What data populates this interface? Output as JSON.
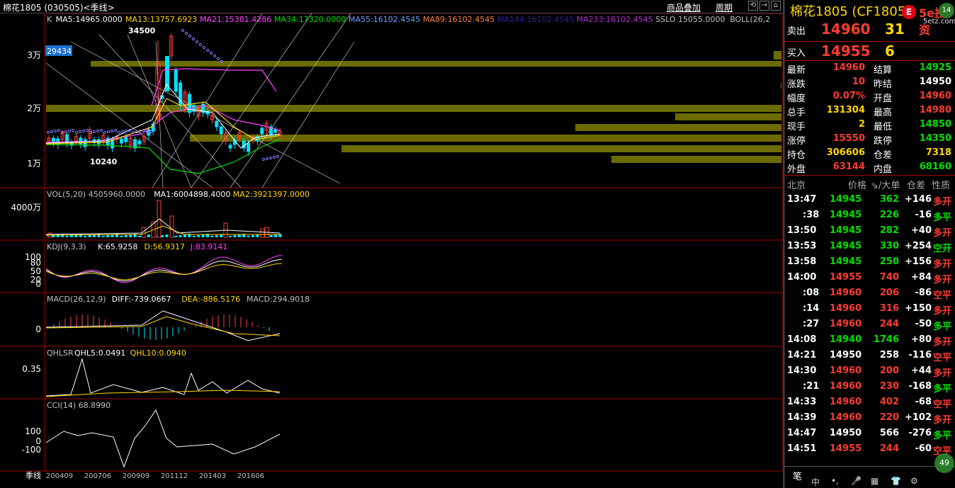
{
  "topbar": {
    "title": "棉花1805 (030505)<季线>",
    "btn_overlay": "商品叠加",
    "btn_period": "周期",
    "icon_back": "⟲",
    "icon_fwd": "→",
    "icon_home": "⌂"
  },
  "main": {
    "legend": [
      {
        "t": "K",
        "c": "#c0c0c0"
      },
      {
        "t": "MA5:14965.0000",
        "c": "#ffffff"
      },
      {
        "t": "MA13:13757.6923",
        "c": "#ffd700"
      },
      {
        "t": "MA21:15381.4286",
        "c": "#ff40ff"
      },
      {
        "t": "MA34:17320.0000",
        "c": "#00e000"
      },
      {
        "t": "MA55:16102.4545",
        "c": "#6aa0ff"
      },
      {
        "t": "MA89:16102.4545",
        "c": "#ff8040"
      },
      {
        "t": "MA144:16102.4545",
        "c": "#1b2a9a"
      },
      {
        "t": "MA233:16102.4545",
        "c": "#b030d0"
      },
      {
        "t": "SSLO 15055.0000",
        "c": "#c0c0c0"
      },
      {
        "t": "BOLL(26,2",
        "c": "#c0c0c0"
      }
    ],
    "y_labels": [
      "3万",
      "2万",
      "1万"
    ],
    "high_tag": "34500",
    "low_tag": "10240",
    "cursor_value": "29434"
  },
  "vol": {
    "legend": [
      {
        "t": "VOL(5,20) 4505960.0000",
        "c": "#c0c0c0"
      },
      {
        "t": "MA1:6004898.4000",
        "c": "#ffffff"
      },
      {
        "t": "MA2:3921397.0000",
        "c": "#ffd700"
      }
    ],
    "y_label": "4000万"
  },
  "kdj": {
    "legend": [
      {
        "t": "KDJ(9,3,3)",
        "c": "#c0c0c0"
      },
      {
        "t": "K:65.9258",
        "c": "#ffffff"
      },
      {
        "t": "D:56.9317",
        "c": "#ffd700"
      },
      {
        "t": "J:83.9141",
        "c": "#ff40ff"
      }
    ],
    "y_labels": [
      "100",
      "80",
      "50",
      "20",
      "0"
    ]
  },
  "macd": {
    "legend": [
      {
        "t": "MACD(26,12,9)",
        "c": "#c0c0c0"
      },
      {
        "t": "DIFF:-739.0667",
        "c": "#ffffff"
      },
      {
        "t": "DEA:-886.5176",
        "c": "#ffd700"
      },
      {
        "t": "MACD:294.9018",
        "c": "#c0c0c0"
      }
    ],
    "y_label": "0"
  },
  "qhlsr": {
    "legend": [
      {
        "t": "QHLSR",
        "c": "#c0c0c0"
      },
      {
        "t": "QHL5:0.0491",
        "c": "#ffffff"
      },
      {
        "t": "QHL10:0.0940",
        "c": "#ffd700"
      }
    ],
    "y_label": "0.35"
  },
  "cci": {
    "legend": [
      {
        "t": "CCI(14) 68.8990",
        "c": "#c0c0c0"
      }
    ],
    "y_labels": [
      "100",
      "0",
      "-100"
    ]
  },
  "x_axis": {
    "period": "季线",
    "labels": [
      "200409",
      "200706",
      "200909",
      "201112",
      "201403",
      "201606"
    ]
  },
  "right": {
    "title": "棉花1805 (CF1805)",
    "logo_main": "5e投资",
    "logo_sub": "5etz.com",
    "logo_char": "E",
    "sell_label": "卖出",
    "sell_price": "14960",
    "sell_vol": "31",
    "buy_label": "买入",
    "buy_price": "14955",
    "buy_vol": "6",
    "stats": [
      {
        "l1": "最新",
        "v1": "14960",
        "c1": "red",
        "l2": "结算",
        "v2": "14925",
        "c2": "green"
      },
      {
        "l1": "涨跌",
        "v1": "10",
        "c1": "red",
        "l2": "昨结",
        "v2": "14950",
        "c2": "white"
      },
      {
        "l1": "幅度",
        "v1": "0.07%",
        "c1": "red",
        "l2": "开盘",
        "v2": "14960",
        "c2": "red"
      },
      {
        "l1": "总手",
        "v1": "131304",
        "c1": "yellow",
        "l2": "最高",
        "v2": "14980",
        "c2": "red"
      },
      {
        "l1": "现手",
        "v1": "2",
        "c1": "yellow",
        "l2": "最低",
        "v2": "14850",
        "c2": "green"
      },
      {
        "l1": "涨停",
        "v1": "15550",
        "c1": "red",
        "l2": "跌停",
        "v2": "14350",
        "c2": "green"
      },
      {
        "l1": "持仓",
        "v1": "306606",
        "c1": "yellow",
        "l2": "仓差",
        "v2": "7318",
        "c2": "yellow"
      },
      {
        "l1": "外盘",
        "v1": "63144",
        "c1": "red",
        "l2": "内盘",
        "v2": "68160",
        "c2": "green"
      }
    ],
    "tick_head": {
      "loc": "北京",
      "price": "价格",
      "vol": "⇘/大单",
      "oi": "仓差",
      "nature": "性质"
    },
    "ticks": [
      {
        "t": "13:47",
        "p": "14945",
        "pc": "green",
        "v": "362",
        "oi": "+146",
        "n": "多开",
        "nc": "red"
      },
      {
        "t": ":38",
        "p": "14945",
        "pc": "green",
        "v": "226",
        "oi": "-16",
        "n": "多平",
        "nc": "green"
      },
      {
        "t": "13:50",
        "p": "14945",
        "pc": "green",
        "v": "282",
        "oi": "+40",
        "n": "多开",
        "nc": "red"
      },
      {
        "t": "13:53",
        "p": "14945",
        "pc": "green",
        "v": "330",
        "oi": "+254",
        "n": "空开",
        "nc": "green"
      },
      {
        "t": "13:58",
        "p": "14945",
        "pc": "green",
        "v": "250",
        "oi": "+156",
        "n": "多开",
        "nc": "red"
      },
      {
        "t": "14:00",
        "p": "14955",
        "pc": "red",
        "v": "740",
        "oi": "+84",
        "n": "多开",
        "nc": "red"
      },
      {
        "t": ":08",
        "p": "14960",
        "pc": "red",
        "v": "206",
        "oi": "-86",
        "n": "空平",
        "nc": "red"
      },
      {
        "t": ":14",
        "p": "14960",
        "pc": "red",
        "v": "316",
        "oi": "+150",
        "n": "多开",
        "nc": "red"
      },
      {
        "t": ":27",
        "p": "14960",
        "pc": "red",
        "v": "244",
        "oi": "-50",
        "n": "多平",
        "nc": "green"
      },
      {
        "t": "14:08",
        "p": "14940",
        "pc": "green",
        "v": "1746",
        "oi": "+80",
        "n": "多开",
        "nc": "red"
      },
      {
        "t": "14:21",
        "p": "14950",
        "pc": "white",
        "v": "258",
        "oi": "-116",
        "n": "空平",
        "nc": "red"
      },
      {
        "t": "14:30",
        "p": "14960",
        "pc": "red",
        "v": "200",
        "oi": "+44",
        "n": "多开",
        "nc": "red"
      },
      {
        "t": ":21",
        "p": "14960",
        "pc": "red",
        "v": "230",
        "oi": "-168",
        "n": "多平",
        "nc": "green"
      },
      {
        "t": "14:33",
        "p": "14960",
        "pc": "red",
        "v": "402",
        "oi": "-68",
        "n": "空平",
        "nc": "red"
      },
      {
        "t": "14:39",
        "p": "14960",
        "pc": "red",
        "v": "220",
        "oi": "+102",
        "n": "多开",
        "nc": "red"
      },
      {
        "t": "14:47",
        "p": "14950",
        "pc": "white",
        "v": "566",
        "oi": "-276",
        "n": "多平",
        "nc": "green"
      },
      {
        "t": "14:51",
        "p": "14955",
        "pc": "red",
        "v": "244",
        "oi": "-60",
        "n": "空平",
        "nc": "red"
      }
    ],
    "footer_label": "笔",
    "corner_badge": "49",
    "corner_badge2": "14",
    "bottom_icons": [
      "中",
      "•,",
      "🎤",
      "▦",
      "👕",
      "⚙"
    ]
  }
}
